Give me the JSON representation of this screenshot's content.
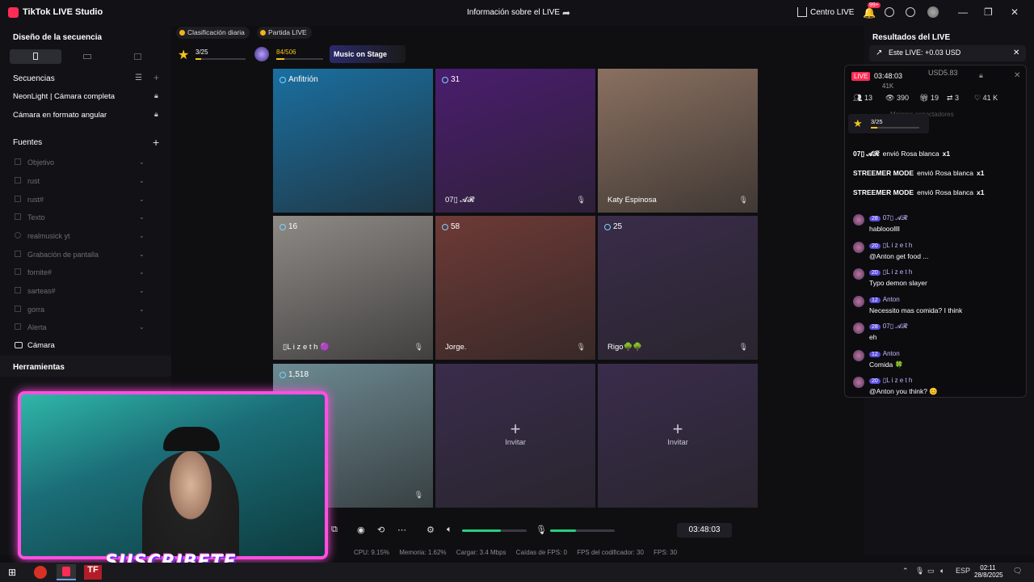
{
  "titlebar": {
    "app_title": "TikTok LIVE Studio",
    "live_info": "Información sobre el LIVE",
    "centro_live": "Centro LIVE",
    "notif_count": "99+"
  },
  "left_panel": {
    "design_title": "Diseño de la secuencia",
    "sequences_title": "Secuencias",
    "sequences": [
      "NeonLight | Cámara completa",
      "Cámara en formato angular"
    ],
    "sources_title": "Fuentes",
    "sources": [
      "Objetivo",
      "rust",
      "rust#",
      "Texto",
      "realmusick yt",
      "Grabación de pantalla",
      "fornite#",
      "sarteas#",
      "gorra",
      "Alerta"
    ],
    "camera_label": "Cámara",
    "tools_title": "Herramientas"
  },
  "toolbar": {
    "ranking_label": "Clasificación diaria",
    "match_label": "Partida LIVE",
    "progress1_text": "3/25",
    "progress1_value": 0.12,
    "progress2_text": "84/506",
    "progress2_value": 0.17,
    "music_label": "Music on Stage"
  },
  "grid": {
    "cells": [
      {
        "badge": "Anfitrión",
        "name": "",
        "bg": "#1a6fa0"
      },
      {
        "badge": "31",
        "name": "07▯ 𝓐𝓡",
        "bg": "#4a1d6e"
      },
      {
        "badge": "",
        "name": "Katy Espinosa",
        "bg": "#8a7060"
      },
      {
        "badge": "16",
        "name": "▯L i z e t h 🟣",
        "bg": "#8e8a86"
      },
      {
        "badge": "58",
        "name": "Jorge.",
        "bg": "#6e3a36"
      },
      {
        "badge": "25",
        "name": "Rigo🌳🌳",
        "bg": "#3a2c4a"
      },
      {
        "badge": "1,518",
        "name": "",
        "bg": "#6d8a92"
      },
      {
        "badge": "",
        "name": "",
        "bg": "#3a2c4c"
      },
      {
        "badge": "",
        "name": "",
        "bg": "#3a2c4c"
      }
    ],
    "invite_label": "Invitar"
  },
  "controls": {
    "timer": "03:48:03",
    "speaker_volume": 0.6,
    "mic_volume": 0.4
  },
  "stats": {
    "cpu": "CPU: 9.15%",
    "memory": "Memoria: 1.62%",
    "upload": "Cargar: 3.4 Mbps",
    "fps_drops": "Caídas de FPS: 0",
    "encoder_fps": "FPS del codificador: 30",
    "fps": "FPS: 30"
  },
  "right_panel": {
    "results_title": "Resultados del LIVE",
    "this_live": "Este LIVE: +0.03 USD",
    "live_tag": "LIVE",
    "live_time": "03:48:03",
    "usd": "USD5.83",
    "likes_top": "41K",
    "stats_viewers": "13",
    "stats_views": "390",
    "stats_gifts": "19",
    "stats_shares": "3",
    "stats_likes": "41 K",
    "top_viewers": "Mejores espectadores",
    "mini_progress": "3/25",
    "gifts": [
      {
        "name": "07▯ 𝓐𝓡",
        "text": "envió Rosa blanca",
        "count": "x1"
      },
      {
        "name": "STREEMER MODE",
        "text": "envió Rosa blanca",
        "count": "x1"
      },
      {
        "name": "STREEMER MODE",
        "text": "envió Rosa blanca",
        "count": "x1"
      }
    ],
    "chat": [
      {
        "level": "28",
        "name": "07▯ 𝓐𝓡",
        "msg": "hablooollll"
      },
      {
        "level": "20",
        "name": "▯L i z e t h",
        "msg": "@Anton get food ..."
      },
      {
        "level": "20",
        "name": "▯L i z e t h",
        "msg": "Typo demon slayer"
      },
      {
        "level": "12",
        "name": "Anton",
        "msg": "Necessito mas comida? I think"
      },
      {
        "level": "28",
        "name": "07▯ 𝓐𝓡",
        "msg": "eh"
      },
      {
        "level": "12",
        "name": "Anton",
        "msg": "Comida 🍀"
      },
      {
        "level": "20",
        "name": "▯L i z e t h",
        "msg": "@Anton you think? 😊"
      }
    ]
  },
  "overlay": {
    "suscribete": "SUSCRIBETE"
  },
  "taskbar": {
    "lang": "ESP",
    "time": "02:11",
    "date": "28/8/2025"
  },
  "colors": {
    "accent": "#fe2c55",
    "green": "#25d07f",
    "overlay_border": "#ff4fe0"
  }
}
